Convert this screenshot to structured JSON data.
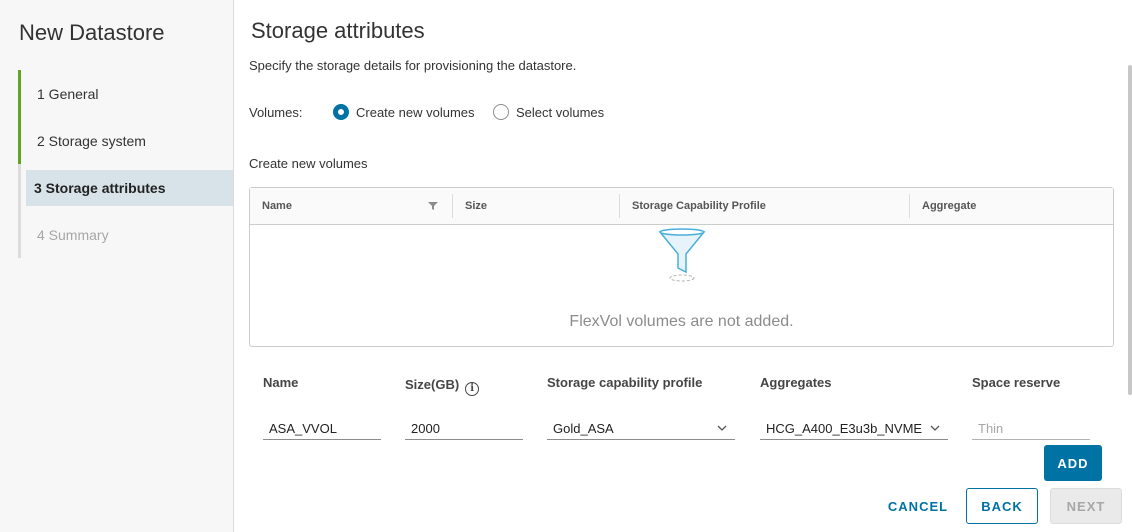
{
  "wizard": {
    "title": "New Datastore",
    "steps": [
      {
        "label": "1  General",
        "state": "done"
      },
      {
        "label": "2  Storage system",
        "state": "done"
      },
      {
        "label": "3  Storage attributes",
        "state": "active"
      },
      {
        "label": "4  Summary",
        "state": "disabled"
      }
    ]
  },
  "page": {
    "title": "Storage attributes",
    "subtitle": "Specify the storage details for provisioning the datastore."
  },
  "volumes": {
    "label": "Volumes:",
    "options": [
      {
        "label": "Create new volumes",
        "selected": true
      },
      {
        "label": "Select volumes",
        "selected": false
      }
    ]
  },
  "grid": {
    "section_label": "Create new volumes",
    "columns": [
      "Name",
      "Size",
      "Storage Capability Profile",
      "Aggregate"
    ],
    "empty_message": "FlexVol volumes are not added.",
    "empty_icon": "funnel-icon"
  },
  "form": {
    "labels": {
      "name": "Name",
      "size": "Size(GB)",
      "profile": "Storage capability profile",
      "aggregates": "Aggregates",
      "space_reserve": "Space reserve"
    },
    "values": {
      "name": "ASA_VVOL",
      "size": "2000",
      "profile": "Gold_ASA",
      "aggregates": "HCG_A400_E3u3b_NVME",
      "space_reserve": "Thin"
    },
    "add_label": "ADD"
  },
  "footer": {
    "cancel": "CANCEL",
    "back": "BACK",
    "next": "NEXT"
  },
  "colors": {
    "accent": "#0072a3",
    "done_step": "#62a420",
    "active_step_bg": "#d8e3e9"
  }
}
